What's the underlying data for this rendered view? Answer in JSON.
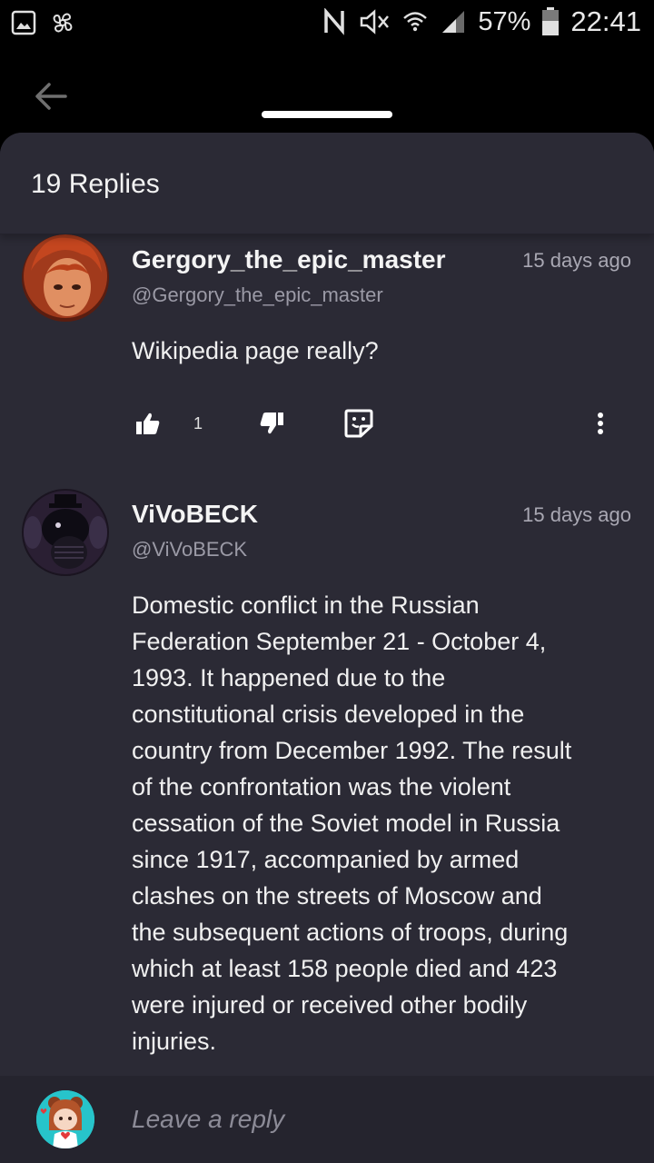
{
  "status_bar": {
    "battery": "57%",
    "time": "22:41"
  },
  "sheet": {
    "title": "19 Replies"
  },
  "comments": [
    {
      "username": "Gergory_the_epic_master",
      "handle": "@Gergory_the_epic_master",
      "time_ago": "15 days ago",
      "text": "Wikipedia page really?",
      "likes": "1"
    },
    {
      "username": "ViVoBECK",
      "handle": "@ViVoBECK",
      "time_ago": "15 days ago",
      "text_lines": [
        "Domestic conflict in the Russian",
        "Federation September 21 - October 4,",
        "1993. It happened due to the",
        "constitutional crisis developed in the",
        "country from December 1992. The result",
        "of the confrontation was the violent",
        "cessation of the Soviet model in Russia",
        "since 1917, accompanied by armed",
        "clashes on the streets of Moscow and",
        "the subsequent actions of troops, during",
        "which at least 158 people died and 423",
        "were injured or received other bodily",
        "injuries."
      ]
    }
  ],
  "reply": {
    "placeholder": "Leave a reply"
  },
  "colors": {
    "sheet_bg": "#2b2a35",
    "reply_bg": "#25242e",
    "muted_text": "#9b9aa6"
  }
}
